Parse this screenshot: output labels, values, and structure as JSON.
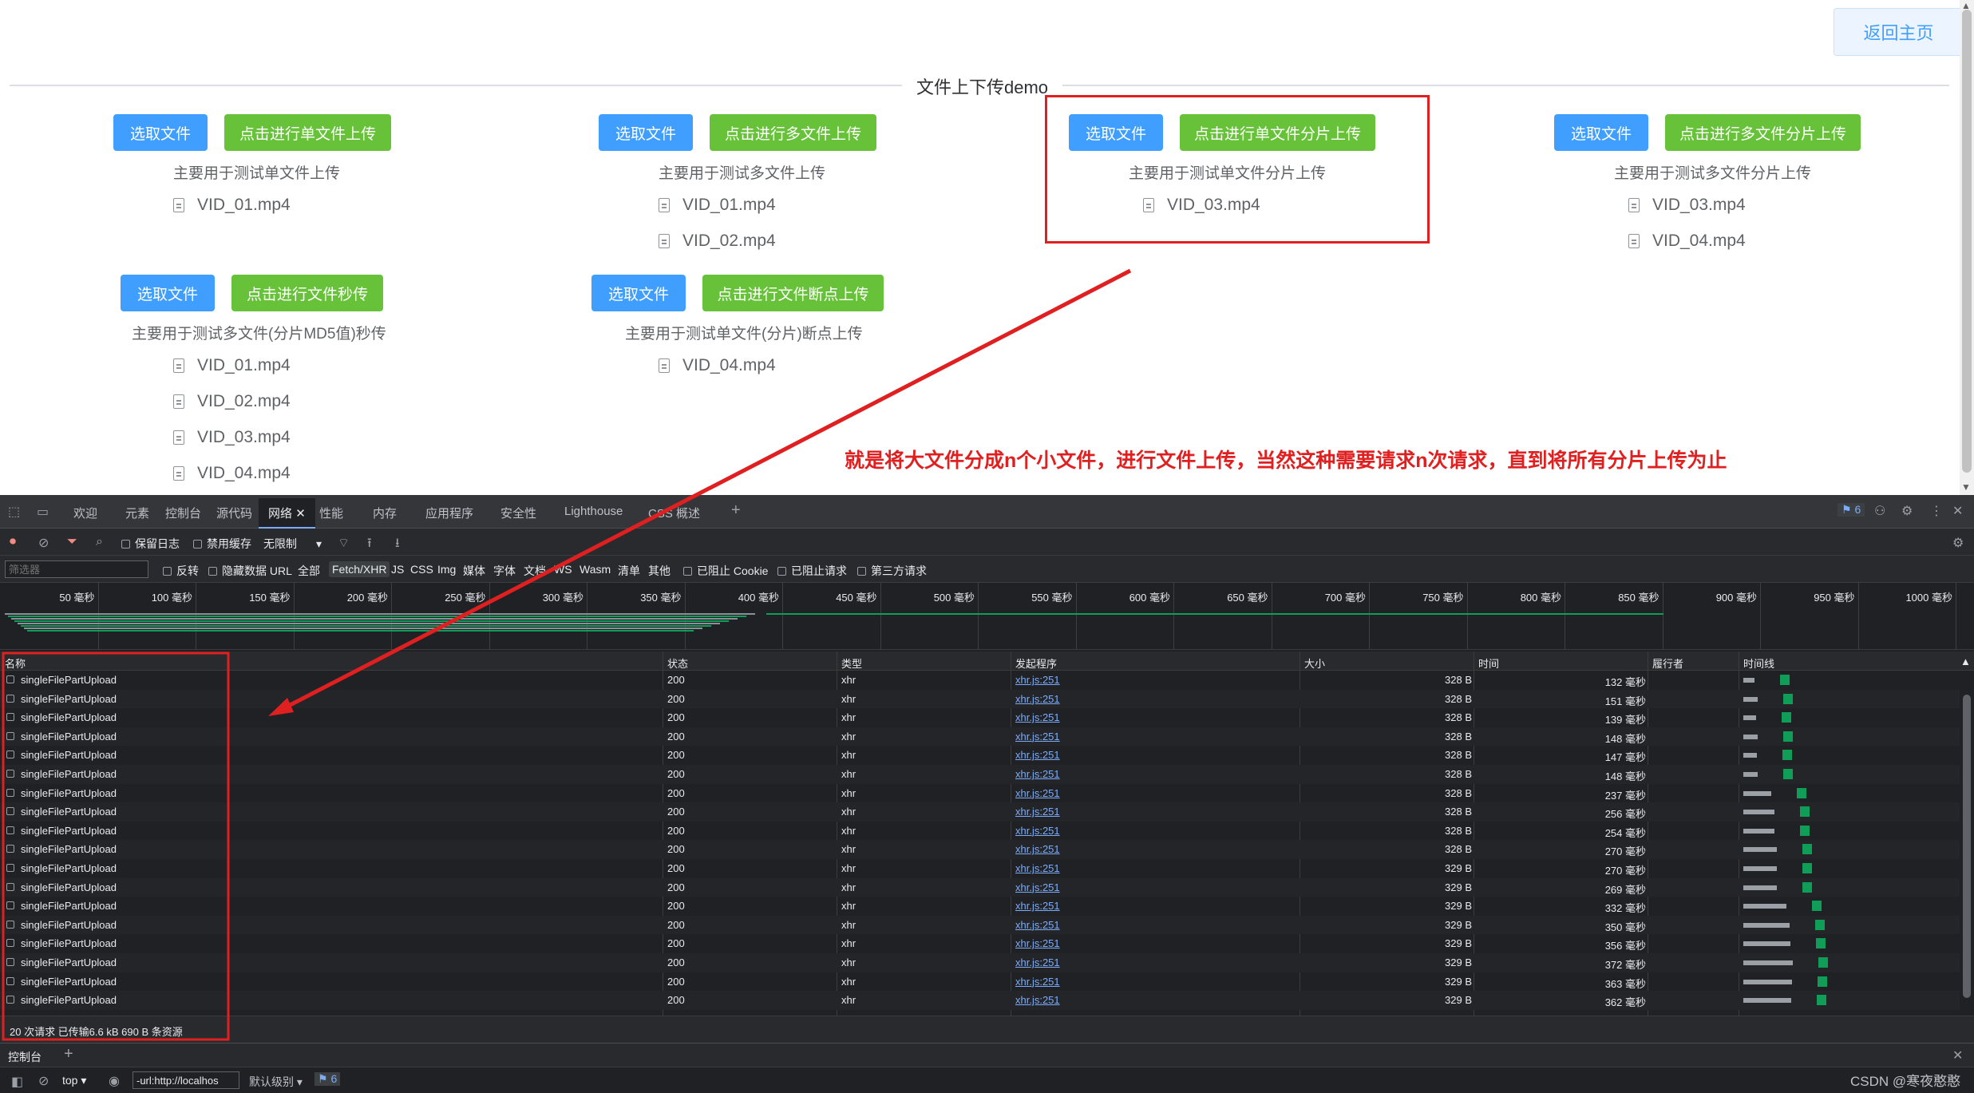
{
  "app": {
    "back_button": "返回主页",
    "divider_title": "文件上下传demo",
    "annotation": "就是将大文件分成n个小文件，进行文件上传，当然这种需要请求n次请求，直到将所有分片上传为止",
    "cards": [
      {
        "select": "选取文件",
        "action": "点击进行单文件上传",
        "desc": "主要用于测试单文件上传",
        "files": [
          "VID_01.mp4"
        ]
      },
      {
        "select": "选取文件",
        "action": "点击进行多文件上传",
        "desc": "主要用于测试多文件上传",
        "files": [
          "VID_01.mp4",
          "VID_02.mp4"
        ]
      },
      {
        "select": "选取文件",
        "action": "点击进行单文件分片上传",
        "desc": "主要用于测试单文件分片上传",
        "files": [
          "VID_03.mp4"
        ]
      },
      {
        "select": "选取文件",
        "action": "点击进行多文件分片上传",
        "desc": "主要用于测试多文件分片上传",
        "files": [
          "VID_03.mp4",
          "VID_04.mp4"
        ]
      },
      {
        "select": "选取文件",
        "action": "点击进行文件秒传",
        "desc": "主要用于测试多文件(分片MD5值)秒传",
        "files": [
          "VID_01.mp4",
          "VID_02.mp4",
          "VID_03.mp4",
          "VID_04.mp4"
        ]
      },
      {
        "select": "选取文件",
        "action": "点击进行文件断点上传",
        "desc": "主要用于测试单文件(分片)断点上传",
        "files": [
          "VID_04.mp4"
        ]
      }
    ]
  },
  "devtools": {
    "tabs": [
      "欢迎",
      "元素",
      "控制台",
      "源代码",
      "网络",
      "性能",
      "内存",
      "应用程序",
      "安全性",
      "Lighthouse",
      "CSS 概述"
    ],
    "active_tab": "网络",
    "issues_count": "6",
    "toolbar1": {
      "preserve_log": "保留日志",
      "disable_cache": "禁用缓存",
      "throttle": "无限制"
    },
    "toolbar2": {
      "filter_placeholder": "筛选器",
      "invert": "反转",
      "hide_data_url": "隐藏数据 URL",
      "types": [
        "全部",
        "Fetch/XHR",
        "JS",
        "CSS",
        "Img",
        "媒体",
        "字体",
        "文档",
        "WS",
        "Wasm",
        "清单",
        "其他"
      ],
      "active_type": "Fetch/XHR",
      "blocked_cookies": "已阻止 Cookie",
      "blocked_requests": "已阻止请求",
      "third_party": "第三方请求"
    },
    "overview_ticks": [
      "50 毫秒",
      "100 毫秒",
      "150 毫秒",
      "200 毫秒",
      "250 毫秒",
      "300 毫秒",
      "350 毫秒",
      "400 毫秒",
      "450 毫秒",
      "500 毫秒",
      "550 毫秒",
      "600 毫秒",
      "650 毫秒",
      "700 毫秒",
      "750 毫秒",
      "800 毫秒",
      "850 毫秒",
      "900 毫秒",
      "950 毫秒",
      "1000 毫秒"
    ],
    "columns": [
      "名称",
      "状态",
      "类型",
      "发起程序",
      "大小",
      "时间",
      "履行者",
      "时间线"
    ],
    "rows": [
      {
        "name": "singleFilePartUpload",
        "status": "200",
        "type": "xhr",
        "initiator": "xhr.js:251",
        "size": "328 B",
        "time": "132 毫秒"
      },
      {
        "name": "singleFilePartUpload",
        "status": "200",
        "type": "xhr",
        "initiator": "xhr.js:251",
        "size": "328 B",
        "time": "151 毫秒"
      },
      {
        "name": "singleFilePartUpload",
        "status": "200",
        "type": "xhr",
        "initiator": "xhr.js:251",
        "size": "328 B",
        "time": "139 毫秒"
      },
      {
        "name": "singleFilePartUpload",
        "status": "200",
        "type": "xhr",
        "initiator": "xhr.js:251",
        "size": "328 B",
        "time": "148 毫秒"
      },
      {
        "name": "singleFilePartUpload",
        "status": "200",
        "type": "xhr",
        "initiator": "xhr.js:251",
        "size": "328 B",
        "time": "147 毫秒"
      },
      {
        "name": "singleFilePartUpload",
        "status": "200",
        "type": "xhr",
        "initiator": "xhr.js:251",
        "size": "328 B",
        "time": "148 毫秒"
      },
      {
        "name": "singleFilePartUpload",
        "status": "200",
        "type": "xhr",
        "initiator": "xhr.js:251",
        "size": "328 B",
        "time": "237 毫秒"
      },
      {
        "name": "singleFilePartUpload",
        "status": "200",
        "type": "xhr",
        "initiator": "xhr.js:251",
        "size": "328 B",
        "time": "256 毫秒"
      },
      {
        "name": "singleFilePartUpload",
        "status": "200",
        "type": "xhr",
        "initiator": "xhr.js:251",
        "size": "328 B",
        "time": "254 毫秒"
      },
      {
        "name": "singleFilePartUpload",
        "status": "200",
        "type": "xhr",
        "initiator": "xhr.js:251",
        "size": "328 B",
        "time": "270 毫秒"
      },
      {
        "name": "singleFilePartUpload",
        "status": "200",
        "type": "xhr",
        "initiator": "xhr.js:251",
        "size": "329 B",
        "time": "270 毫秒"
      },
      {
        "name": "singleFilePartUpload",
        "status": "200",
        "type": "xhr",
        "initiator": "xhr.js:251",
        "size": "329 B",
        "time": "269 毫秒"
      },
      {
        "name": "singleFilePartUpload",
        "status": "200",
        "type": "xhr",
        "initiator": "xhr.js:251",
        "size": "329 B",
        "time": "332 毫秒"
      },
      {
        "name": "singleFilePartUpload",
        "status": "200",
        "type": "xhr",
        "initiator": "xhr.js:251",
        "size": "329 B",
        "time": "350 毫秒"
      },
      {
        "name": "singleFilePartUpload",
        "status": "200",
        "type": "xhr",
        "initiator": "xhr.js:251",
        "size": "329 B",
        "time": "356 毫秒"
      },
      {
        "name": "singleFilePartUpload",
        "status": "200",
        "type": "xhr",
        "initiator": "xhr.js:251",
        "size": "329 B",
        "time": "372 毫秒"
      },
      {
        "name": "singleFilePartUpload",
        "status": "200",
        "type": "xhr",
        "initiator": "xhr.js:251",
        "size": "329 B",
        "time": "363 毫秒"
      },
      {
        "name": "singleFilePartUpload",
        "status": "200",
        "type": "xhr",
        "initiator": "xhr.js:251",
        "size": "329 B",
        "time": "362 毫秒"
      }
    ],
    "summary": "20 次请求  已传输6.6 kB  690 B 条资源",
    "drawer_tab": "控制台",
    "console": {
      "context": "top",
      "filter_value": "-url:http://localhos",
      "level": "默认级别",
      "issues": "6"
    }
  },
  "watermark": "CSDN @寒夜憨憨"
}
